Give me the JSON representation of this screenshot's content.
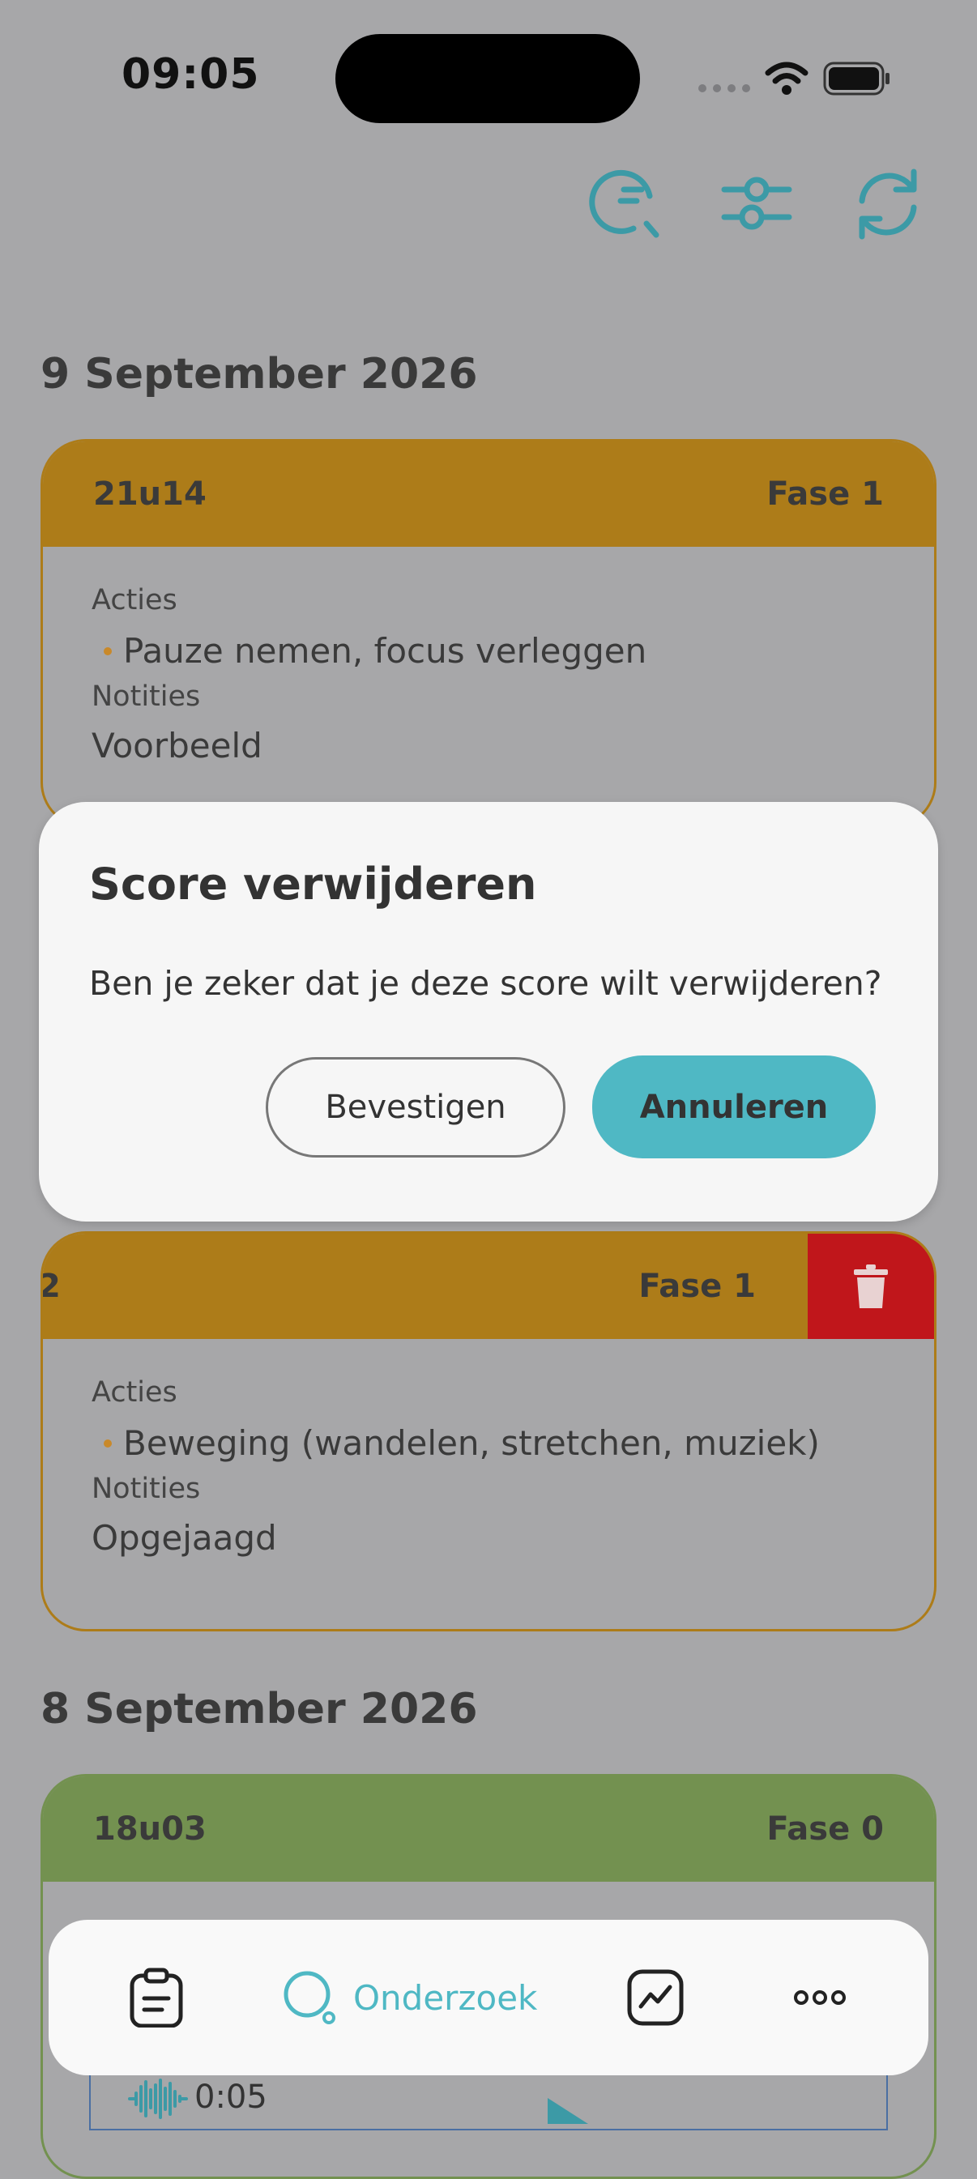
{
  "status_bar": {
    "time": "09:05"
  },
  "colors": {
    "accent": "#4fb8c4",
    "phase1": "#ad7c19",
    "phase0": "#739150",
    "delete": "#c0161b"
  },
  "icons": {
    "top": [
      "search-history-icon",
      "sliders-icon",
      "refresh-icon"
    ],
    "tabs": [
      "clipboard-icon",
      "search-icon",
      "chart-icon",
      "more-icon"
    ]
  },
  "sections": [
    {
      "date": "9 September 2026",
      "entries": [
        {
          "time": "21u14",
          "phase": "Fase 1",
          "actions_label": "Acties",
          "actions": [
            "Pauze nemen, focus verleggen"
          ],
          "notes_label": "Notities",
          "notes": "Voorbeeld"
        },
        {
          "time_partial": "2",
          "phase": "Fase 1",
          "actions_label": "Acties",
          "actions": [
            "Beweging (wandelen, stretchen, muziek)"
          ],
          "notes_label": "Notities",
          "notes": "Opgejaagd"
        }
      ]
    },
    {
      "date": "8 September 2026",
      "entries": [
        {
          "time": "18u03",
          "phase": "Fase 0",
          "audio_duration": "0:05"
        }
      ]
    }
  ],
  "dialog": {
    "title": "Score verwijderen",
    "message": "Ben je zeker dat je deze score wilt verwijderen?",
    "confirm_label": "Bevestigen",
    "cancel_label": "Annuleren"
  },
  "tabbar": {
    "active_label": "Onderzoek"
  }
}
